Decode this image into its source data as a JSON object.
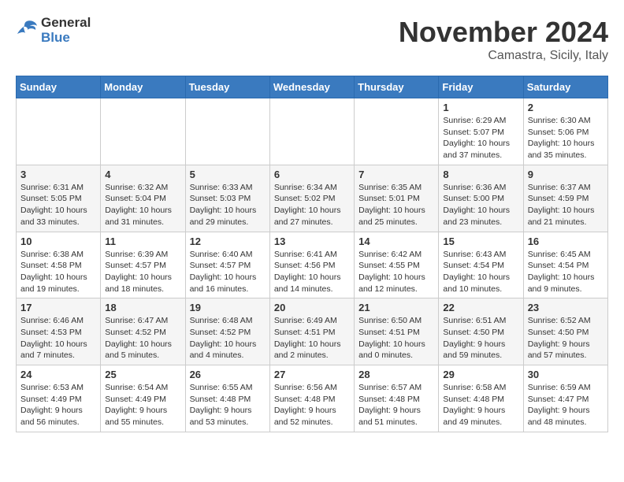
{
  "logo": {
    "text_general": "General",
    "text_blue": "Blue"
  },
  "title": "November 2024",
  "location": "Camastra, Sicily, Italy",
  "weekdays": [
    "Sunday",
    "Monday",
    "Tuesday",
    "Wednesday",
    "Thursday",
    "Friday",
    "Saturday"
  ],
  "weeks": [
    [
      {
        "day": "",
        "info": ""
      },
      {
        "day": "",
        "info": ""
      },
      {
        "day": "",
        "info": ""
      },
      {
        "day": "",
        "info": ""
      },
      {
        "day": "",
        "info": ""
      },
      {
        "day": "1",
        "info": "Sunrise: 6:29 AM\nSunset: 5:07 PM\nDaylight: 10 hours and 37 minutes."
      },
      {
        "day": "2",
        "info": "Sunrise: 6:30 AM\nSunset: 5:06 PM\nDaylight: 10 hours and 35 minutes."
      }
    ],
    [
      {
        "day": "3",
        "info": "Sunrise: 6:31 AM\nSunset: 5:05 PM\nDaylight: 10 hours and 33 minutes."
      },
      {
        "day": "4",
        "info": "Sunrise: 6:32 AM\nSunset: 5:04 PM\nDaylight: 10 hours and 31 minutes."
      },
      {
        "day": "5",
        "info": "Sunrise: 6:33 AM\nSunset: 5:03 PM\nDaylight: 10 hours and 29 minutes."
      },
      {
        "day": "6",
        "info": "Sunrise: 6:34 AM\nSunset: 5:02 PM\nDaylight: 10 hours and 27 minutes."
      },
      {
        "day": "7",
        "info": "Sunrise: 6:35 AM\nSunset: 5:01 PM\nDaylight: 10 hours and 25 minutes."
      },
      {
        "day": "8",
        "info": "Sunrise: 6:36 AM\nSunset: 5:00 PM\nDaylight: 10 hours and 23 minutes."
      },
      {
        "day": "9",
        "info": "Sunrise: 6:37 AM\nSunset: 4:59 PM\nDaylight: 10 hours and 21 minutes."
      }
    ],
    [
      {
        "day": "10",
        "info": "Sunrise: 6:38 AM\nSunset: 4:58 PM\nDaylight: 10 hours and 19 minutes."
      },
      {
        "day": "11",
        "info": "Sunrise: 6:39 AM\nSunset: 4:57 PM\nDaylight: 10 hours and 18 minutes."
      },
      {
        "day": "12",
        "info": "Sunrise: 6:40 AM\nSunset: 4:57 PM\nDaylight: 10 hours and 16 minutes."
      },
      {
        "day": "13",
        "info": "Sunrise: 6:41 AM\nSunset: 4:56 PM\nDaylight: 10 hours and 14 minutes."
      },
      {
        "day": "14",
        "info": "Sunrise: 6:42 AM\nSunset: 4:55 PM\nDaylight: 10 hours and 12 minutes."
      },
      {
        "day": "15",
        "info": "Sunrise: 6:43 AM\nSunset: 4:54 PM\nDaylight: 10 hours and 10 minutes."
      },
      {
        "day": "16",
        "info": "Sunrise: 6:45 AM\nSunset: 4:54 PM\nDaylight: 10 hours and 9 minutes."
      }
    ],
    [
      {
        "day": "17",
        "info": "Sunrise: 6:46 AM\nSunset: 4:53 PM\nDaylight: 10 hours and 7 minutes."
      },
      {
        "day": "18",
        "info": "Sunrise: 6:47 AM\nSunset: 4:52 PM\nDaylight: 10 hours and 5 minutes."
      },
      {
        "day": "19",
        "info": "Sunrise: 6:48 AM\nSunset: 4:52 PM\nDaylight: 10 hours and 4 minutes."
      },
      {
        "day": "20",
        "info": "Sunrise: 6:49 AM\nSunset: 4:51 PM\nDaylight: 10 hours and 2 minutes."
      },
      {
        "day": "21",
        "info": "Sunrise: 6:50 AM\nSunset: 4:51 PM\nDaylight: 10 hours and 0 minutes."
      },
      {
        "day": "22",
        "info": "Sunrise: 6:51 AM\nSunset: 4:50 PM\nDaylight: 9 hours and 59 minutes."
      },
      {
        "day": "23",
        "info": "Sunrise: 6:52 AM\nSunset: 4:50 PM\nDaylight: 9 hours and 57 minutes."
      }
    ],
    [
      {
        "day": "24",
        "info": "Sunrise: 6:53 AM\nSunset: 4:49 PM\nDaylight: 9 hours and 56 minutes."
      },
      {
        "day": "25",
        "info": "Sunrise: 6:54 AM\nSunset: 4:49 PM\nDaylight: 9 hours and 55 minutes."
      },
      {
        "day": "26",
        "info": "Sunrise: 6:55 AM\nSunset: 4:48 PM\nDaylight: 9 hours and 53 minutes."
      },
      {
        "day": "27",
        "info": "Sunrise: 6:56 AM\nSunset: 4:48 PM\nDaylight: 9 hours and 52 minutes."
      },
      {
        "day": "28",
        "info": "Sunrise: 6:57 AM\nSunset: 4:48 PM\nDaylight: 9 hours and 51 minutes."
      },
      {
        "day": "29",
        "info": "Sunrise: 6:58 AM\nSunset: 4:48 PM\nDaylight: 9 hours and 49 minutes."
      },
      {
        "day": "30",
        "info": "Sunrise: 6:59 AM\nSunset: 4:47 PM\nDaylight: 9 hours and 48 minutes."
      }
    ]
  ]
}
